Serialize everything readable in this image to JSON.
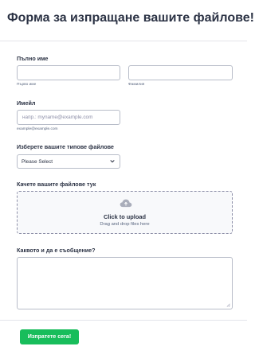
{
  "form": {
    "title": "Форма за изпращане вашите файлове!",
    "full_name": {
      "label": "Пълно име",
      "first_sublabel": "Първо име",
      "last_sublabel": "Фамилия",
      "first_value": "",
      "last_value": ""
    },
    "email": {
      "label": "Имейл",
      "placeholder": "напр.: myname@example.com",
      "sublabel": "example@example.com",
      "value": ""
    },
    "file_type": {
      "label": "Изберете вашите типове файлове",
      "selected": "Please Select",
      "icon": "chevron-down-icon"
    },
    "upload": {
      "label": "Качете вашите файлове тук",
      "title": "Click to upload",
      "subtitle": "Drag and drop files here",
      "icon": "cloud-upload-icon"
    },
    "message": {
      "label": "Каквото и да е съобщение?",
      "value": ""
    },
    "submit_label": "Изпратете сега!"
  },
  "colors": {
    "accent": "#18bd5b",
    "text": "#2c3345",
    "border": "#b8bdc9",
    "muted": "#57647e"
  }
}
